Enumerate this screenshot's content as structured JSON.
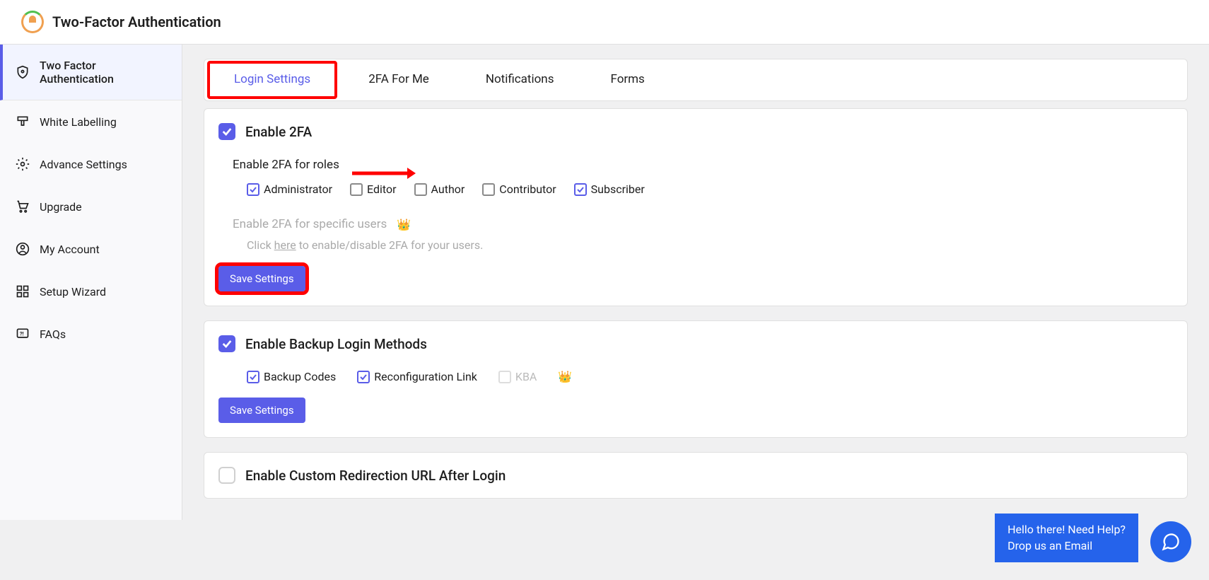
{
  "header": {
    "title": "Two-Factor Authentication"
  },
  "sidebar": {
    "items": [
      {
        "label": "Two Factor Authentication"
      },
      {
        "label": "White Labelling"
      },
      {
        "label": "Advance Settings"
      },
      {
        "label": "Upgrade"
      },
      {
        "label": "My Account"
      },
      {
        "label": "Setup Wizard"
      },
      {
        "label": "FAQs"
      }
    ]
  },
  "tabs": {
    "items": [
      {
        "label": "Login Settings"
      },
      {
        "label": "2FA For Me"
      },
      {
        "label": "Notifications"
      },
      {
        "label": "Forms"
      }
    ]
  },
  "enable2fa": {
    "title": "Enable 2FA",
    "rolesHeading": "Enable 2FA for roles",
    "roles": [
      {
        "label": "Administrator"
      },
      {
        "label": "Editor"
      },
      {
        "label": "Author"
      },
      {
        "label": "Contributor"
      },
      {
        "label": "Subscriber"
      }
    ],
    "specificUsers": "Enable 2FA for specific users",
    "hintPrefix": "Click ",
    "hintLink": "here",
    "hintSuffix": " to enable/disable 2FA for your users.",
    "saveBtn": "Save Settings"
  },
  "backup": {
    "title": "Enable Backup Login Methods",
    "codes": "Backup Codes",
    "reconfig": "Reconfiguration Link",
    "kba": "KBA",
    "saveBtn": "Save Settings"
  },
  "redirect": {
    "title": "Enable Custom Redirection URL After Login"
  },
  "help": {
    "line1": "Hello there! Need Help?",
    "line2": "Drop us an Email"
  }
}
